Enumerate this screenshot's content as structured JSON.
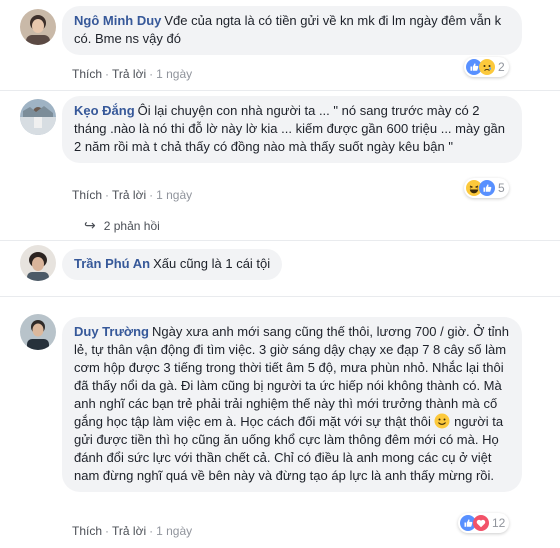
{
  "comments": [
    {
      "author": "Ngô Minh Duy",
      "text": "Vđe của ngta là có tiền gửi về kn mk đi lm ngày đêm vẫn k có. Bme ns vậy đó",
      "actions": {
        "like": "Thích",
        "reply": "Trả lời",
        "time": "1 ngày"
      },
      "reaction_count": "2",
      "reaction_icons": [
        "like-icon",
        "sad-icon"
      ]
    },
    {
      "author": "Kẹo Đắng",
      "text": "Ôi lại chuyện con nhà người ta ... \" nó sang trước mày có 2 tháng .nào là nó thi đỗ lờ này lờ kia ... kiếm được gần 600 triệu ... mày gần 2 năm rồi mà t chả thấy có đồng nào mà thấy suốt ngày kêu bận \"",
      "actions": {
        "like": "Thích",
        "reply": "Trả lời",
        "time": "1 ngày"
      },
      "reaction_count": "5",
      "reaction_icons": [
        "haha-icon",
        "like-icon"
      ],
      "replies_label": "2 phản hồi"
    },
    {
      "author": "Trần Phú An",
      "text": "Xấu cũng là 1 cái tội"
    },
    {
      "author": "Duy Trường",
      "text_before_emoji": "Ngày xưa anh mới sang cũng thế thôi, lương 700 / giờ. Ở tỉnh lẻ, tự thân vận động đi tìm việc. 3 giờ sáng dậy chạy xe đạp 7 8 cây số làm cơm hộp được 3 tiếng trong thời tiết âm 5 độ, mưa phùn nhỏ. Nhắc lại thôi đã thấy nổi da gà. Đi làm cũng bị người ta ức hiếp nói không thành có. Mà anh nghĩ các bạn trẻ phải trải nghiệm thế này thì mới trưởng thành mà cố gắng học tập làm việc em à. Học cách đối mặt với sự thật thôi",
      "text_after_emoji": "người ta gửi được tiền thì họ cũng ăn uống khổ cực làm thông đêm mới có mà. Họ đánh đổi sức lực với thần chết cả. Chỉ có điều là anh mong các cụ ở việt nam đừng nghĩ quá về bên này và đừng tạo áp lực là anh thấy mừng rồi.",
      "actions": {
        "like": "Thích",
        "reply": "Trả lời",
        "time": "1 ngày"
      },
      "reaction_count": "12",
      "reaction_icons": [
        "like-icon",
        "love-icon"
      ]
    }
  ],
  "colors": {
    "author": "#365899",
    "bubble": "#f2f3f5",
    "meta": "#90949c",
    "like": "#5890ff",
    "love": "#f25268",
    "emoji": "#fcc93c"
  }
}
